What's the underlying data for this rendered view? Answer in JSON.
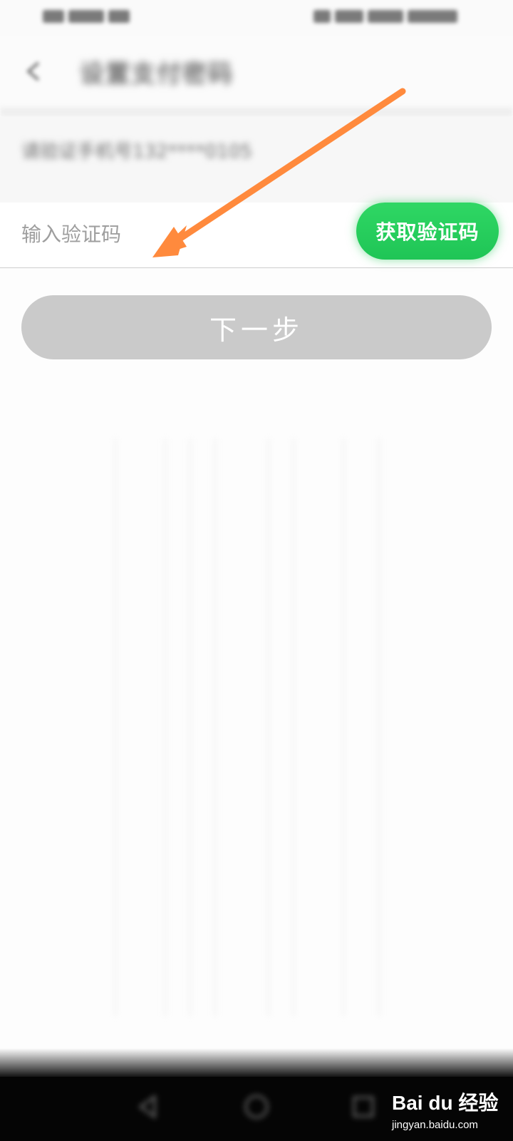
{
  "status_bar": {},
  "title_bar": {
    "back_icon": "back-arrow-icon",
    "title": "设置支付密码"
  },
  "phone_row": {
    "hint": "请验证手机号132****0105"
  },
  "code_row": {
    "input_value": "",
    "input_placeholder": "输入验证码",
    "get_code_label": "获取验证码",
    "get_code_color": "#22CC5C"
  },
  "next_button": {
    "label": "下一步",
    "color": "#CACACA"
  },
  "nav_bar": {
    "icons": [
      "back-triangle-icon",
      "home-circle-icon",
      "recent-square-icon"
    ]
  },
  "watermark": {
    "brand": "Bai du 经验",
    "url": "jingyan.baidu.com"
  },
  "annotation": {
    "color": "#FF8A3D"
  }
}
